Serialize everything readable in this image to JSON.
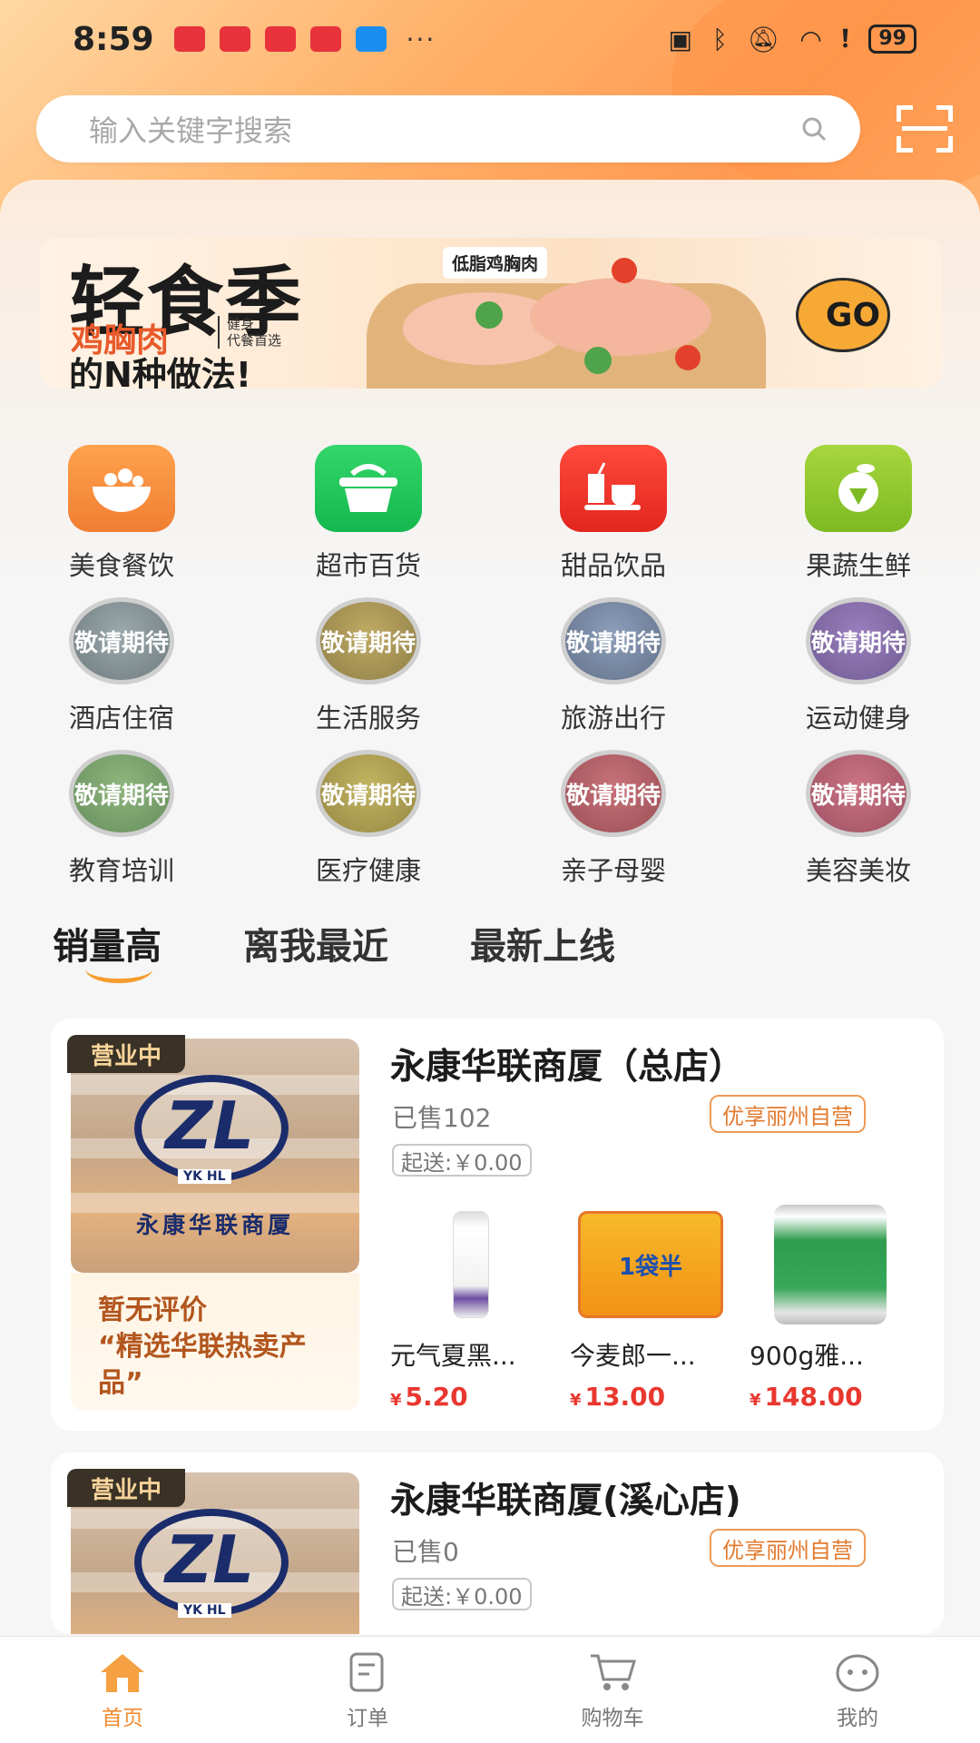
{
  "status_bar": {
    "time": "8:59",
    "dots": "···",
    "battery": "99"
  },
  "search": {
    "placeholder": "输入关键字搜索"
  },
  "banner": {
    "title": "轻食季",
    "subtitle1": "鸡胸肉",
    "small_text_1": "健身",
    "small_text_2": "代餐首选",
    "subtitle2": "的N种做法!",
    "tag": "低脂鸡胸肉",
    "go_label": "GO"
  },
  "categories": [
    {
      "label": "美食餐饮",
      "icon": "food-bowl-icon"
    },
    {
      "label": "超市百货",
      "icon": "basket-icon"
    },
    {
      "label": "甜品饮品",
      "icon": "drink-icon"
    },
    {
      "label": "果蔬生鲜",
      "icon": "fruit-icon"
    },
    {
      "label": "酒店住宿",
      "icon": "hotel-icon",
      "badge": "敬请期待"
    },
    {
      "label": "生活服务",
      "icon": "service-icon",
      "badge": "敬请期待"
    },
    {
      "label": "旅游出行",
      "icon": "travel-icon",
      "badge": "敬请期待"
    },
    {
      "label": "运动健身",
      "icon": "sport-icon",
      "badge": "敬请期待"
    },
    {
      "label": "教育培训",
      "icon": "education-icon",
      "badge": "敬请期待"
    },
    {
      "label": "医疗健康",
      "icon": "medical-icon",
      "badge": "敬请期待"
    },
    {
      "label": "亲子母婴",
      "icon": "baby-icon",
      "badge": "敬请期待"
    },
    {
      "label": "美容美妆",
      "icon": "beauty-icon",
      "badge": "敬请期待"
    }
  ],
  "sort_tabs": [
    "销量高",
    "离我最近",
    "最新上线"
  ],
  "stores": [
    {
      "status": "营业中",
      "name": "永康华联商厦（总店）",
      "logo_text": "永康华联商厦",
      "logo_letters": "YK HL",
      "sold": "已售102",
      "tag": "优享丽州自营",
      "min_order": "起送:￥0.00",
      "review_line1": "暂无评价",
      "review_line2": "“精选华联热卖产品”",
      "products": [
        {
          "name": "元气夏黑...",
          "price": "5.20",
          "currency": "¥"
        },
        {
          "name": "今麦郎一...",
          "price": "13.00",
          "currency": "¥"
        },
        {
          "name": "900g雅...",
          "price": "148.00",
          "currency": "¥"
        }
      ]
    },
    {
      "status": "营业中",
      "name": "永康华联商厦(溪心店)",
      "logo_letters": "YK HL",
      "sold": "已售0",
      "tag": "优享丽州自营",
      "min_order": "起送:￥0.00"
    }
  ],
  "product_images": {
    "noodle_text": "1袋半"
  },
  "tabbar": [
    {
      "label": "首页",
      "icon": "home-icon"
    },
    {
      "label": "订单",
      "icon": "order-icon"
    },
    {
      "label": "购物车",
      "icon": "cart-icon"
    },
    {
      "label": "我的",
      "icon": "profile-icon"
    }
  ],
  "colors": {
    "accent": "#f28a2f",
    "price": "#e8382f",
    "tag_border": "#ee9a56"
  }
}
